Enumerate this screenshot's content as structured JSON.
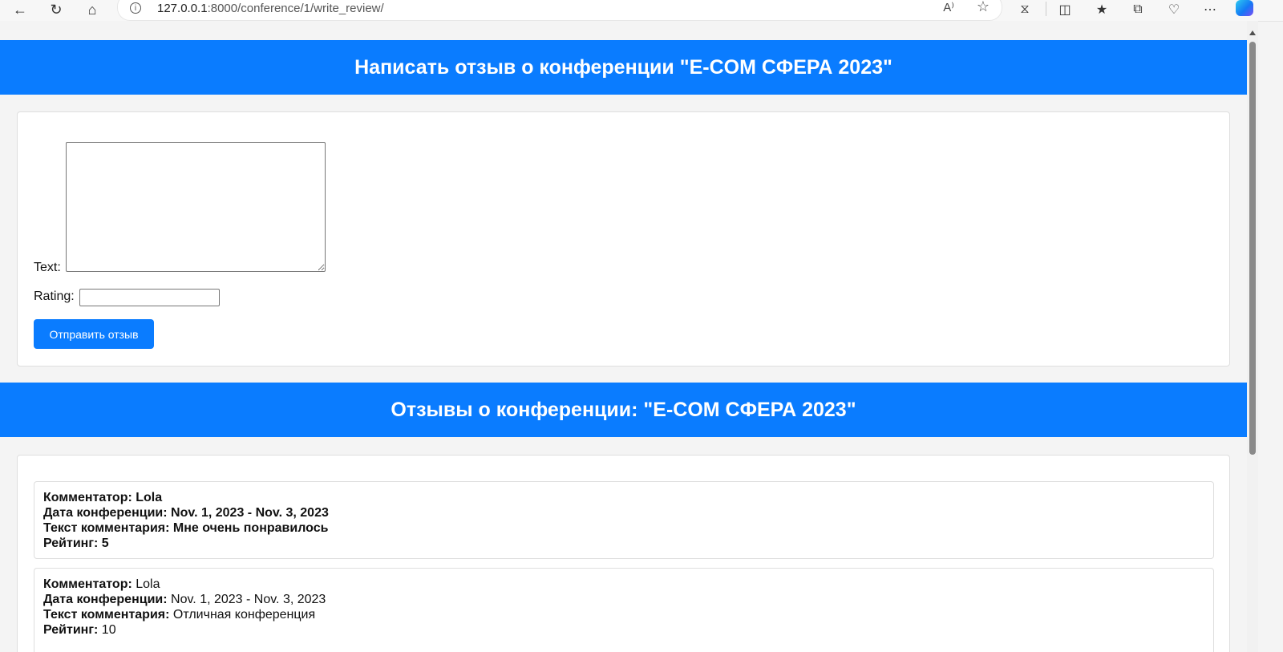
{
  "browser": {
    "url_host": "127.0.0.1",
    "url_rest": ":8000/conference/1/write_review/"
  },
  "write_section": {
    "title": "Написать отзыв о конференции \"E-COM СФЕРА 2023\"",
    "text_label": "Text:",
    "text_value": "",
    "rating_label": "Rating:",
    "rating_value": "",
    "submit_label": "Отправить отзыв"
  },
  "reviews_section": {
    "title": "Отзывы о конференции: \"E-COM СФЕРА 2023\"",
    "reviews": [
      {
        "commenter_key": "Комментатор:",
        "commenter": "Lola",
        "date_key": "Дата конференции:",
        "date": "Nov. 1, 2023 - Nov. 3, 2023",
        "text_key": "Текст комментария:",
        "text": "Мне очень понравилось",
        "rating_key": "Рейтинг:",
        "rating": "5"
      },
      {
        "commenter_key": "Комментатор:",
        "commenter": "Lola",
        "date_key": "Дата конференции:",
        "date": "Nov. 1, 2023 - Nov. 3, 2023",
        "text_key": "Текст комментария:",
        "text": "Отличная конференция",
        "rating_key": "Рейтинг:",
        "rating": "10"
      }
    ]
  },
  "colors": {
    "accent": "#0a7cff",
    "page_bg": "#f4f4f4"
  }
}
